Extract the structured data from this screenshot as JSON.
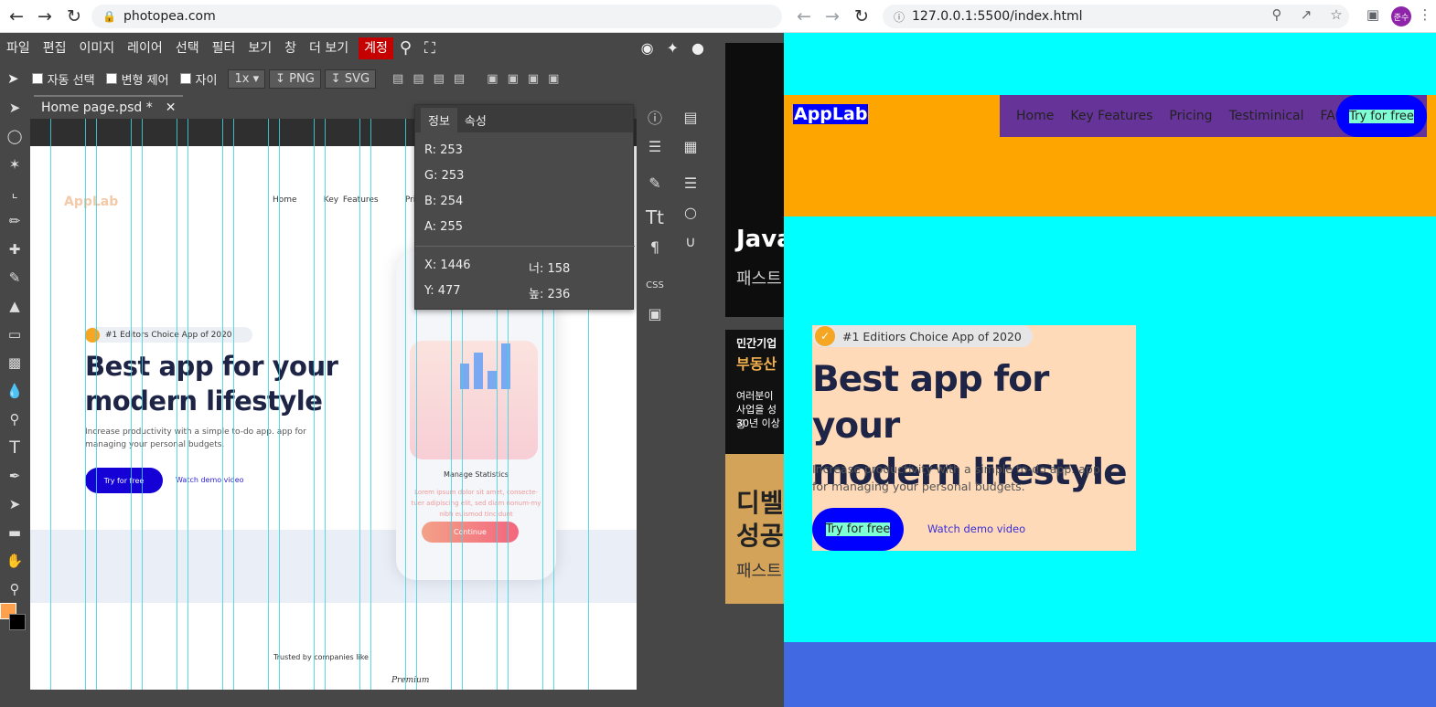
{
  "left_browser": {
    "url": "photopea.com",
    "menu": [
      "파일",
      "편집",
      "이미지",
      "레이어",
      "선택",
      "필터",
      "보기",
      "창",
      "더 보기"
    ],
    "account": "계정",
    "options": {
      "auto_select": "자동 선택",
      "transform": "변형 제어",
      "distance": "자이",
      "zoom": "1x",
      "png": "PNG",
      "svg": "SVG"
    },
    "doc_tab": "Home page.psd *",
    "info_panel": {
      "tabs": [
        "정보",
        "속성"
      ],
      "r": "R: 253",
      "g": "G: 253",
      "b": "B: 254",
      "a": "A: 255",
      "x": "X: 1446",
      "y": "Y: 477",
      "w": "너: 158",
      "h": "높: 236"
    },
    "canvas": {
      "logo": "AppLab",
      "nav": [
        "Home",
        "Key Features",
        "Pricing"
      ],
      "badge": "#1 Editors Choice App of 2020",
      "headline1": "Best app for your",
      "headline2": "modern lifestyle",
      "subtext1": "Increase productivity with a simple to-do app. app for",
      "subtext2": "managing your personal budgets.",
      "try": "Try for free",
      "watch": "Watch demo video",
      "manage": "Manage Statistics",
      "lorem": "Lorem ipsum dolor sit amet, consecte-tuer adipiscing elit, sed diam nonum-my nibh euismod tincidunt",
      "continue": "Continue",
      "trusted": "Trusted by companies like",
      "premium": "Premium"
    },
    "ads": {
      "ad1_title": "Java",
      "ad1_sub": "패스트",
      "ad2_line1": "민간기업",
      "ad2_line2": "부동산",
      "ad2_quote": "여러분이",
      "ad2_q2": "사업을 성공",
      "ad2_q3": "30년 이상",
      "ad2_big1": "디벨",
      "ad2_big2": "성공",
      "ad2_foot": "패스트"
    }
  },
  "right_browser": {
    "url": "127.0.0.1:5500/index.html",
    "profile": "준수",
    "logo": "AppLab",
    "nav": [
      "Home",
      "Key Features",
      "Pricing",
      "Testiminical",
      "FAQ"
    ],
    "try_top": "Try for free",
    "badge": "#1 Editiors Choice App of 2020",
    "headline1": "Best app for your",
    "headline2": "modern lifestyle",
    "subtext": "Increase productivity with a simple to-do app. app for managing your personal budgets.",
    "try": "Try for free",
    "watch": "Watch demo video"
  }
}
